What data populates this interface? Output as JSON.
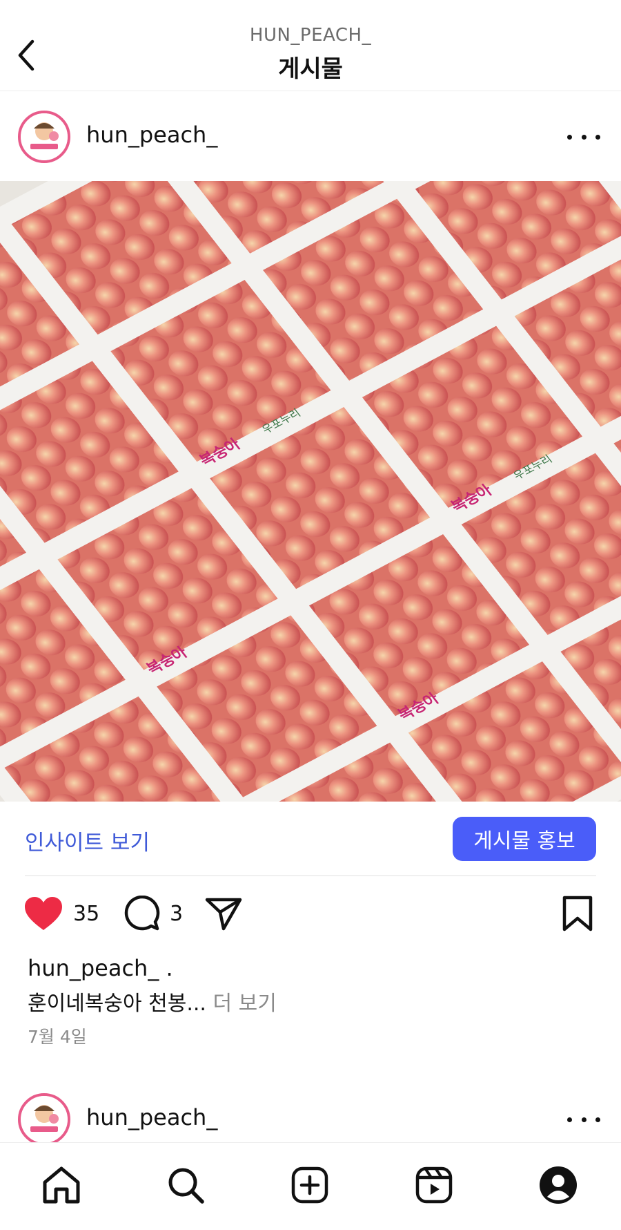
{
  "header": {
    "subtitle": "HUN_PEACH_",
    "title": "게시물"
  },
  "post": {
    "username": "hun_peach_",
    "insight_label": "인사이트 보기",
    "promote_label": "게시물 홍보",
    "likes": "35",
    "comments": "3",
    "caption_user": "hun_peach_ .",
    "caption_text": "훈이네복숭아 천봉...",
    "caption_more": "더 보기",
    "date": "7월 4일"
  },
  "next_post": {
    "username": "hun_peach_"
  },
  "image_labels": {
    "box_brand": "복숭아",
    "box_sub": "우포누리"
  },
  "colors": {
    "accent": "#4a5df9",
    "link": "#3f5ad8",
    "like": "#ed2b45",
    "avatar_ring": "#e85b8a"
  },
  "icons": [
    "chevron-left-icon",
    "more-icon",
    "heart-icon",
    "comment-icon",
    "share-icon",
    "bookmark-icon",
    "home-icon",
    "search-icon",
    "add-icon",
    "reels-icon",
    "profile-icon"
  ]
}
